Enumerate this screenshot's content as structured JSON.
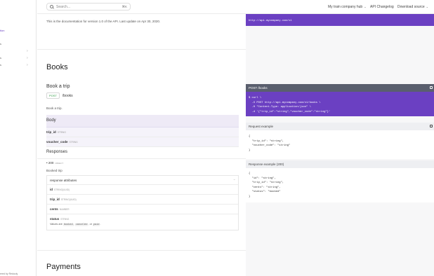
{
  "sidebar": {
    "fragments": [
      "tion",
      "s",
      "s",
      "s"
    ],
    "footer": "ered by Redocly"
  },
  "topbar": {
    "search_placeholder": "Search...",
    "search_shortcut": "⌘K",
    "nav": [
      {
        "label": "My train company hub"
      },
      {
        "label": "API Changelog"
      },
      {
        "label": "Download source"
      }
    ]
  },
  "main": {
    "version_note": "This is the documentation for version 1.0 of the API. Last update on Apr 30, 2020.",
    "books_title": "Books",
    "operation_title": "Book a trip",
    "method": "POST",
    "path": "/books",
    "description": "Book a trip.",
    "body_label": "Body",
    "body_params": [
      {
        "name": "trip_id",
        "type": "STRING"
      },
      {
        "name": "voucher_code",
        "type": "STRING"
      }
    ],
    "responses_label": "Responses",
    "status_code": "• 200",
    "status_type": "OBJECT",
    "response_desc": "Booked trip",
    "response_attributes_label": "response attributes",
    "attributes": [
      {
        "name": "id",
        "type": "STRING(UUID)"
      },
      {
        "name": "trip_id",
        "type": "STRING(UUID)"
      },
      {
        "name": "cents",
        "type": "NUMBER"
      },
      {
        "name": "status",
        "type": "STRING"
      }
    ],
    "values_prefix": "Values are",
    "values": [
      "booked",
      "canceled",
      "paid"
    ],
    "payments_title": "Payments"
  },
  "right": {
    "top_url": "http://api.mycompany.com/v1",
    "curl_header": "POST /books",
    "curl_lines": [
      "$ curl \\",
      "  -X POST http://api.mycompany.com/v1/books \\",
      "  -H \"Content-Type: application/json\" \\",
      "  -d '{\"trip_id\":\"string\",\"voucher_code\":\"string\"}'"
    ],
    "request_header": "Request example",
    "request_lines": [
      "{",
      "  \"trip_id\": \"string\",",
      "  \"voucher_code\": \"string\"",
      "}"
    ],
    "response_header": "Response example (200)",
    "response_lines": [
      "{",
      "  \"id\": \"string\",",
      "  \"trip_id\": \"string\",",
      "  \"cents\": \"string\",",
      "  \"status\": \"booked\"",
      "}"
    ]
  },
  "colors": {
    "accent": "#6b40c2",
    "post_badge": "#2e9a43"
  }
}
